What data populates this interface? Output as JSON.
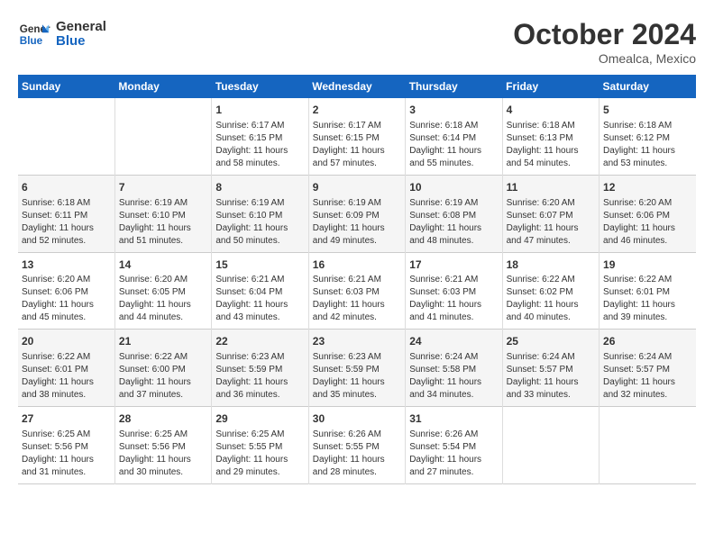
{
  "header": {
    "logo_line1": "General",
    "logo_line2": "Blue",
    "month": "October 2024",
    "location": "Omealca, Mexico"
  },
  "weekdays": [
    "Sunday",
    "Monday",
    "Tuesday",
    "Wednesday",
    "Thursday",
    "Friday",
    "Saturday"
  ],
  "weeks": [
    [
      {
        "day": "",
        "info": ""
      },
      {
        "day": "",
        "info": ""
      },
      {
        "day": "1",
        "info": "Sunrise: 6:17 AM\nSunset: 6:15 PM\nDaylight: 11 hours and 58 minutes."
      },
      {
        "day": "2",
        "info": "Sunrise: 6:17 AM\nSunset: 6:15 PM\nDaylight: 11 hours and 57 minutes."
      },
      {
        "day": "3",
        "info": "Sunrise: 6:18 AM\nSunset: 6:14 PM\nDaylight: 11 hours and 55 minutes."
      },
      {
        "day": "4",
        "info": "Sunrise: 6:18 AM\nSunset: 6:13 PM\nDaylight: 11 hours and 54 minutes."
      },
      {
        "day": "5",
        "info": "Sunrise: 6:18 AM\nSunset: 6:12 PM\nDaylight: 11 hours and 53 minutes."
      }
    ],
    [
      {
        "day": "6",
        "info": "Sunrise: 6:18 AM\nSunset: 6:11 PM\nDaylight: 11 hours and 52 minutes."
      },
      {
        "day": "7",
        "info": "Sunrise: 6:19 AM\nSunset: 6:10 PM\nDaylight: 11 hours and 51 minutes."
      },
      {
        "day": "8",
        "info": "Sunrise: 6:19 AM\nSunset: 6:10 PM\nDaylight: 11 hours and 50 minutes."
      },
      {
        "day": "9",
        "info": "Sunrise: 6:19 AM\nSunset: 6:09 PM\nDaylight: 11 hours and 49 minutes."
      },
      {
        "day": "10",
        "info": "Sunrise: 6:19 AM\nSunset: 6:08 PM\nDaylight: 11 hours and 48 minutes."
      },
      {
        "day": "11",
        "info": "Sunrise: 6:20 AM\nSunset: 6:07 PM\nDaylight: 11 hours and 47 minutes."
      },
      {
        "day": "12",
        "info": "Sunrise: 6:20 AM\nSunset: 6:06 PM\nDaylight: 11 hours and 46 minutes."
      }
    ],
    [
      {
        "day": "13",
        "info": "Sunrise: 6:20 AM\nSunset: 6:06 PM\nDaylight: 11 hours and 45 minutes."
      },
      {
        "day": "14",
        "info": "Sunrise: 6:20 AM\nSunset: 6:05 PM\nDaylight: 11 hours and 44 minutes."
      },
      {
        "day": "15",
        "info": "Sunrise: 6:21 AM\nSunset: 6:04 PM\nDaylight: 11 hours and 43 minutes."
      },
      {
        "day": "16",
        "info": "Sunrise: 6:21 AM\nSunset: 6:03 PM\nDaylight: 11 hours and 42 minutes."
      },
      {
        "day": "17",
        "info": "Sunrise: 6:21 AM\nSunset: 6:03 PM\nDaylight: 11 hours and 41 minutes."
      },
      {
        "day": "18",
        "info": "Sunrise: 6:22 AM\nSunset: 6:02 PM\nDaylight: 11 hours and 40 minutes."
      },
      {
        "day": "19",
        "info": "Sunrise: 6:22 AM\nSunset: 6:01 PM\nDaylight: 11 hours and 39 minutes."
      }
    ],
    [
      {
        "day": "20",
        "info": "Sunrise: 6:22 AM\nSunset: 6:01 PM\nDaylight: 11 hours and 38 minutes."
      },
      {
        "day": "21",
        "info": "Sunrise: 6:22 AM\nSunset: 6:00 PM\nDaylight: 11 hours and 37 minutes."
      },
      {
        "day": "22",
        "info": "Sunrise: 6:23 AM\nSunset: 5:59 PM\nDaylight: 11 hours and 36 minutes."
      },
      {
        "day": "23",
        "info": "Sunrise: 6:23 AM\nSunset: 5:59 PM\nDaylight: 11 hours and 35 minutes."
      },
      {
        "day": "24",
        "info": "Sunrise: 6:24 AM\nSunset: 5:58 PM\nDaylight: 11 hours and 34 minutes."
      },
      {
        "day": "25",
        "info": "Sunrise: 6:24 AM\nSunset: 5:57 PM\nDaylight: 11 hours and 33 minutes."
      },
      {
        "day": "26",
        "info": "Sunrise: 6:24 AM\nSunset: 5:57 PM\nDaylight: 11 hours and 32 minutes."
      }
    ],
    [
      {
        "day": "27",
        "info": "Sunrise: 6:25 AM\nSunset: 5:56 PM\nDaylight: 11 hours and 31 minutes."
      },
      {
        "day": "28",
        "info": "Sunrise: 6:25 AM\nSunset: 5:56 PM\nDaylight: 11 hours and 30 minutes."
      },
      {
        "day": "29",
        "info": "Sunrise: 6:25 AM\nSunset: 5:55 PM\nDaylight: 11 hours and 29 minutes."
      },
      {
        "day": "30",
        "info": "Sunrise: 6:26 AM\nSunset: 5:55 PM\nDaylight: 11 hours and 28 minutes."
      },
      {
        "day": "31",
        "info": "Sunrise: 6:26 AM\nSunset: 5:54 PM\nDaylight: 11 hours and 27 minutes."
      },
      {
        "day": "",
        "info": ""
      },
      {
        "day": "",
        "info": ""
      }
    ]
  ]
}
